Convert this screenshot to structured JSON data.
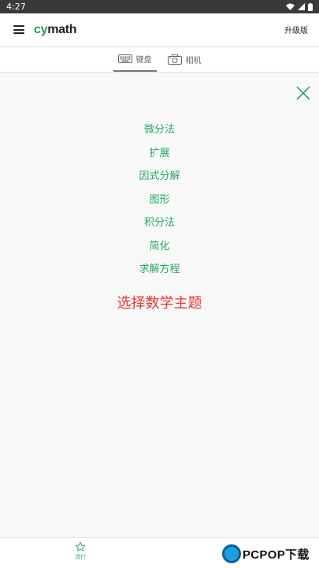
{
  "status": {
    "time": "4:27"
  },
  "appbar": {
    "logo_cy": "cy",
    "logo_math": "math",
    "upgrade": "升级版"
  },
  "modes": [
    {
      "label": "键盘",
      "icon": "keyboard-icon"
    },
    {
      "label": "相机",
      "icon": "camera-icon"
    }
  ],
  "topics": [
    "微分法",
    "扩展",
    "因式分解",
    "图形",
    "积分法",
    "简化",
    "求解方程"
  ],
  "headline": "选择数学主题",
  "bottom_nav": {
    "popular_label": "流行"
  },
  "watermark": {
    "text": "PCPOP下载"
  },
  "colors": {
    "accent_green": "#25a864",
    "headline_red": "#e23a2e",
    "status_bar": "#3a3a3a"
  }
}
